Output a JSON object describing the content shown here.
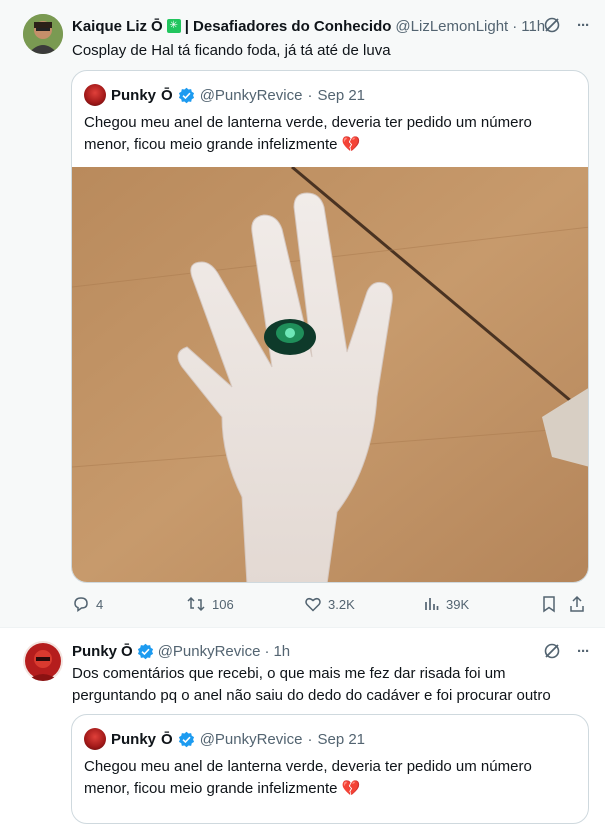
{
  "tweets": [
    {
      "author_name": "Kaique Liz",
      "author_suffix": "| Desafiadores do Conhecido",
      "badge_text": "Ō",
      "handle": "@LizLemonLight",
      "time": "11h",
      "text": "Cosplay de Hal tá ficando foda, já tá até de luva",
      "quote": {
        "author_name": "Punky",
        "badge_text": "Ō",
        "handle": "@PunkyRevice",
        "time": "Sep 21",
        "text": "Chegou meu anel de lanterna verde, deveria ter pedido um número menor, ficou meio grande infelizmente 💔"
      },
      "actions": {
        "replies": "4",
        "reposts": "106",
        "likes": "3.2K",
        "views": "39K"
      }
    },
    {
      "author_name": "Punky",
      "badge_text": "Ō",
      "handle": "@PunkyRevice",
      "time": "1h",
      "text_line1": "Dos comentários que recebi, o que mais me fez dar risada foi um",
      "text_line2": "perguntando pq o anel não saiu do dedo do cadáver e foi procurar outro",
      "quote": {
        "author_name": "Punky",
        "badge_text": "Ō",
        "handle": "@PunkyRevice",
        "time": "Sep 21",
        "text": "Chegou meu anel de lanterna verde, deveria ter pedido um número menor, ficou meio grande infelizmente 💔"
      }
    }
  ],
  "dot": "·",
  "more_label": "···",
  "icons": [
    "grok-icon",
    "more-icon",
    "verified-icon",
    "reply-icon",
    "repost-icon",
    "like-icon",
    "views-icon",
    "bookmark-icon",
    "share-icon"
  ],
  "colors": {
    "verified": "#1d9bf0",
    "muted": "#536471",
    "ring": "#1f8f5a"
  }
}
